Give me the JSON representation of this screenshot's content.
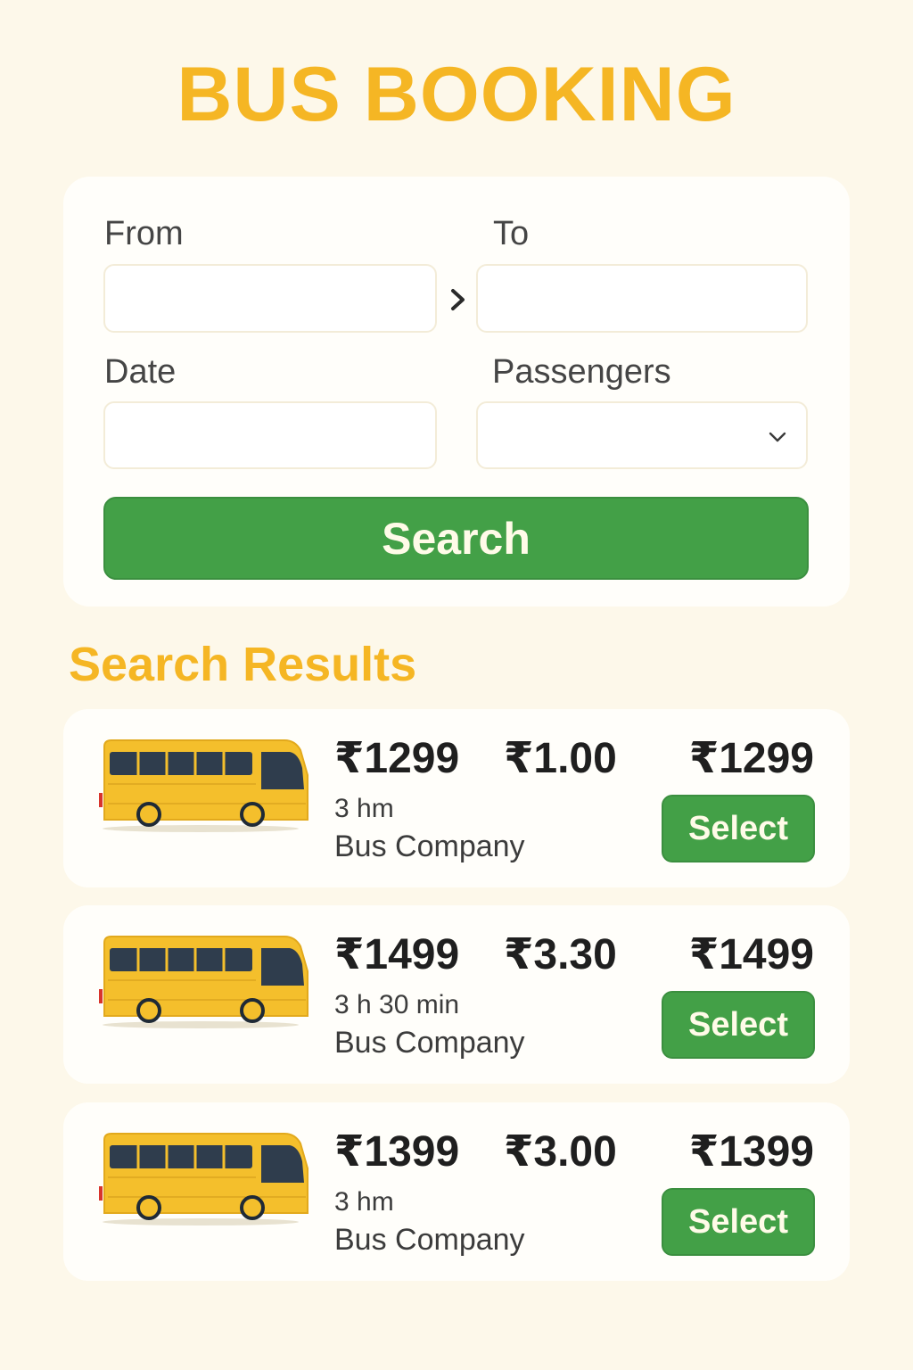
{
  "app": {
    "title": "BUS BOOKING"
  },
  "search_form": {
    "from_label": "From",
    "from_value": "",
    "to_label": "To",
    "to_value": "",
    "date_label": "Date",
    "date_value": "",
    "passengers_label": "Passengers",
    "passengers_value": "",
    "search_label": "Search"
  },
  "results": {
    "heading": "Search Results",
    "items": [
      {
        "fare": "₹1299",
        "fare_secondary": "₹1.00",
        "duration": "3 hm",
        "operator": "Bus Company",
        "fare_right": "₹1299",
        "select_label": "Select"
      },
      {
        "fare": "₹1499",
        "fare_secondary": "₹3.30",
        "duration": "3 h 30 min",
        "operator": "Bus Company",
        "fare_right": "₹1499",
        "select_label": "Select"
      },
      {
        "fare": "₹1399",
        "fare_secondary": "₹3.00",
        "duration": "3 hm",
        "operator": "Bus Company",
        "fare_right": "₹1399",
        "select_label": "Select"
      }
    ]
  },
  "icons": {
    "route_arrow": "chevron-right-icon",
    "dropdown": "chevron-down-icon",
    "bus": "bus-icon"
  },
  "colors": {
    "accent_yellow": "#f5b624",
    "primary_green": "#43a047",
    "background": "#fdf8ea"
  }
}
